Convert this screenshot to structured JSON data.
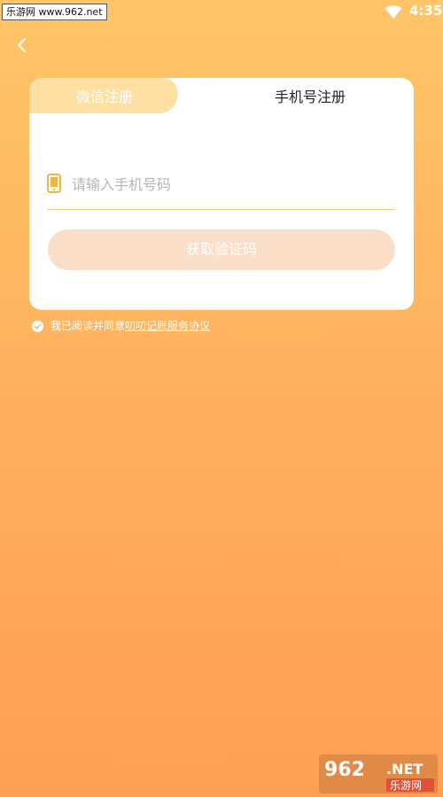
{
  "status_bar": {
    "time": "4:35",
    "watermark": "乐游网 www.962.net"
  },
  "icons": {
    "back": "chevron-left-icon",
    "wifi": "wifi-icon",
    "phone": "phone-icon",
    "check": "check-circle-icon"
  },
  "tabs": [
    {
      "label": "微信注册",
      "active": false
    },
    {
      "label": "手机号注册",
      "active": true
    }
  ],
  "phone_input": {
    "placeholder": "请输入手机号码",
    "value": ""
  },
  "get_code_button": "获取验证码",
  "agreement": {
    "prefix": "我已阅读并同意",
    "link": "叨叨记账服务协议"
  },
  "watermark_br": {
    "brand": "962",
    "suffix": ".NET",
    "cn": "乐游网"
  },
  "colors": {
    "bg_top": "#FFC566",
    "bg_bottom": "#FF9F52",
    "accent": "#F5B23C",
    "button": "#FBDEC8",
    "divider": "#F2C779"
  }
}
